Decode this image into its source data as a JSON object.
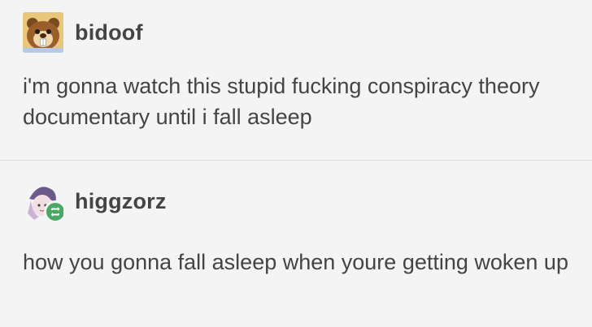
{
  "posts": [
    {
      "username": "bidoof",
      "text": "i'm gonna watch this stupid fucking conspiracy theory documentary until i fall asleep",
      "avatar_icon": "bidoof-avatar-icon",
      "avatar_bg": "#e9c77a"
    },
    {
      "username": "higgzorz",
      "text": "how you gonna fall asleep when youre getting woken up",
      "avatar_icon": "higgzorz-avatar-icon",
      "reblog_icon": "reblog-icon",
      "reblog_color": "#4aa865"
    }
  ]
}
